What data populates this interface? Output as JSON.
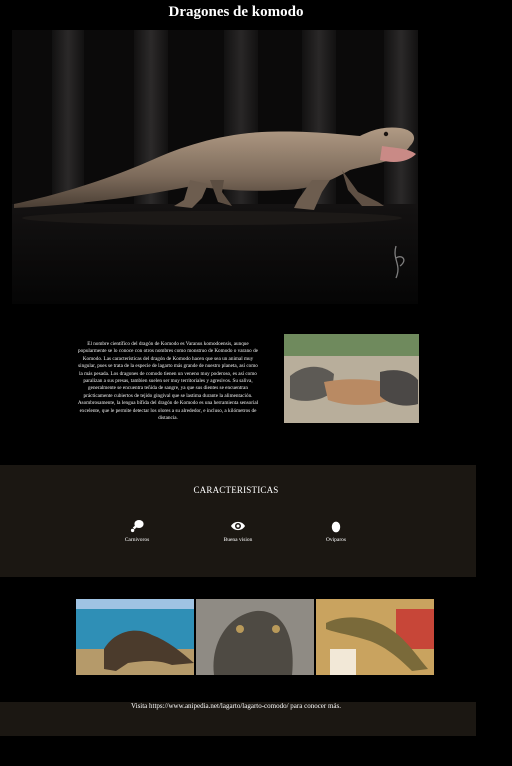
{
  "page": {
    "title": "Dragones de komodo"
  },
  "intro": {
    "text": "El nombre científico del dragón de Komodo es Varanus komodoensis, aunque popularmente se lo conoce con otros nombres como monstruo de Komodo o varano de Komodo. Las características del dragón de Komodo hacen que sea un animal muy singular, pues se trata de la especie de lagarto más grande de nuestro planeta, así como la más pesada. Los dragones de comodo tienen un veneno muy poderoso, es así como paralizan a sus presas, tambien suelen ser muy territoriales y agresivos. Su saliva, generalmente se encuentra teñida de sangre, ya que sus dientes se encuentran prácticamente cubiertos de tejido gingival que se lastima durante la alimentación. Asombrosamente, la lengua bífida del dragón de Komodo es una herramienta sensorial excelente, que le permite detectar los olores a su alrededor, e incluso, a kilómetros de distancia."
  },
  "features": {
    "title": "CARACTERISTICAS",
    "items": [
      {
        "label": "Carnivoros",
        "icon": "drumstick-icon"
      },
      {
        "label": "Buena vision",
        "icon": "eye-icon"
      },
      {
        "label": "Oviparos",
        "icon": "egg-icon"
      }
    ]
  },
  "footer": {
    "text": "Visita https://www.anipedia.net/lagarto/lagarto-comodo/ para conocer más."
  }
}
